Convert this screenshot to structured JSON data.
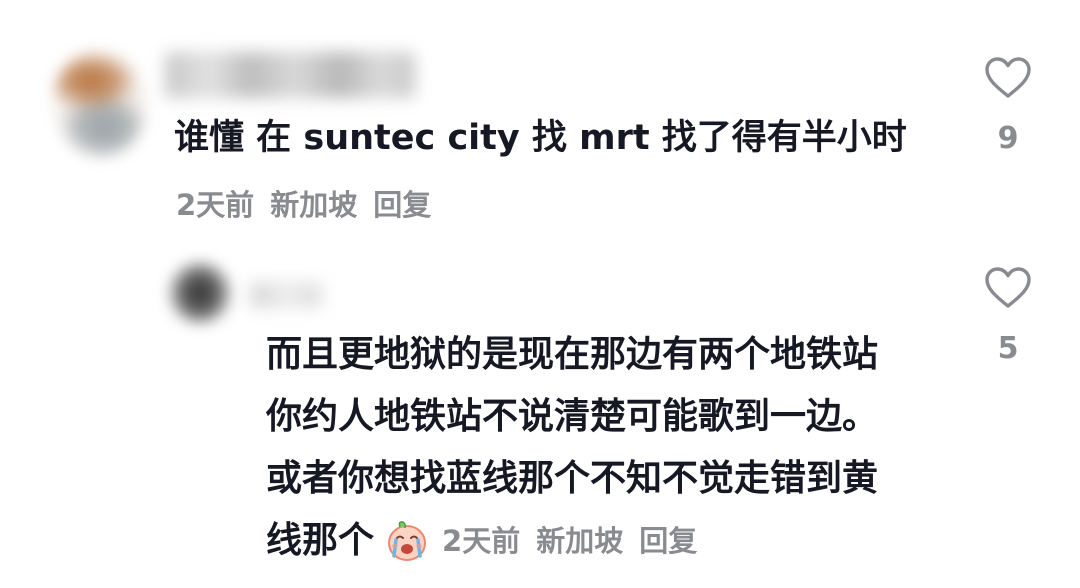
{
  "comment": {
    "text": "谁懂 在 suntec city 找 mrt 找了得有半小时",
    "meta": {
      "time": "2天前",
      "location": "新加坡",
      "reply_label": "回复"
    },
    "likes": "9"
  },
  "reply": {
    "lines": [
      "而且更地狱的是现在那边有两个地铁站",
      "你约人地铁站不说清楚可能歌到一边。",
      "或者你想找蓝线那个不知不觉走错到黄",
      "线那个"
    ],
    "emoji": "crying-face-emoji",
    "meta": {
      "time": "2天前",
      "location": "新加坡",
      "reply_label": "回复"
    },
    "likes": "5"
  },
  "icons": {
    "heart": "heart-outline-icon"
  },
  "colors": {
    "text": "#161823",
    "meta": "#8a8b91",
    "heart_stroke": "#8a8b91"
  }
}
